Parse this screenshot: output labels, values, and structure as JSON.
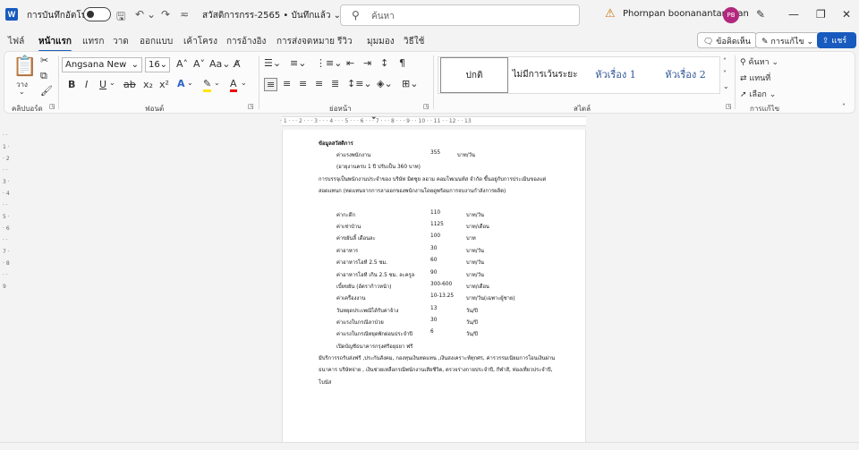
{
  "titlebar": {
    "autosave_label": "การบันทึกอัตโนมัติ",
    "doc_title": "สวัสดิการกรร-2565 • บันทึกแล้ว ⌄",
    "search_placeholder": "ค้นหา",
    "user_name": "Phornpan boonanantanasan",
    "avatar_initials": "PB"
  },
  "menu": {
    "tabs": [
      "ไฟล์",
      "หน้าแรก",
      "แทรก",
      "วาด",
      "ออกแบบ",
      "เค้าโครง",
      "การอ้างอิง",
      "การส่งจดหมาย",
      "รีวิว",
      "มุมมอง",
      "วิธีใช้"
    ],
    "comments_label": "ข้อคิดเห็น",
    "editing_label": "การแก้ไข",
    "share_label": "แชร์"
  },
  "ribbon": {
    "paste_label": "วาง",
    "clipboard_label": "คลิปบอร์ด",
    "font_name": "Angsana New",
    "font_size": "16",
    "font_group_label": "ฟอนต์",
    "paragraph_group_label": "ย่อหน้า",
    "styles_group_label": "สไตล์",
    "editing_group_label": "การแก้ไข",
    "styles": [
      "ปกติ",
      "ไม่มีการเว้นระยะ",
      "หัวเรื่อง 1",
      "หัวเรื่อง 2"
    ],
    "find_label": "ค้นหา",
    "replace_label": "แทนที่",
    "select_label": "เลือก"
  },
  "document": {
    "heading": "ข้อมูลสวัสดิการ",
    "lines": [
      {
        "label": "ค่าแรงพนักงาน",
        "value": "355",
        "unit": "บาท/วัน"
      },
      {
        "label": "(อายุงานครบ 1 ปี ปรับเป็น 360 บาท)",
        "value": "",
        "unit": ""
      },
      {
        "label": "การบรรจุเป็นพนักงานประจำของ บริษัท มิตซูย ลอาม คอมโพเนนท์ส จำกัด ขึ้นอยู่กับการประเมินของแต่",
        "value": "",
        "unit": ""
      },
      {
        "label": "สอดแทนก (ทดแทนจากการลาออกของพนักงานโดยดูพร้อมการจบงานกำลังการผลิต)",
        "value": "",
        "unit": ""
      }
    ],
    "items": [
      {
        "label": "ค่ากะดึก",
        "value": "110",
        "unit": "บาท/วัน"
      },
      {
        "label": "ค่าเช่าบ้าน",
        "value": "1125",
        "unit": "บาท/เดือน"
      },
      {
        "label": "ค่าขยันลี้ เดือนละ",
        "value": "100",
        "unit": "บาท"
      },
      {
        "label": "ค่าอาหาร",
        "value": "30",
        "unit": "บาท/วัน"
      },
      {
        "label": "ค่าอาหารโอที 2.5 ชม.",
        "value": "60",
        "unit": "บาท/วัน"
      },
      {
        "label": "ค่าอาหารโอที เกิน 2.5 ชม. ละครูล",
        "value": "90",
        "unit": "บาท/วัน"
      },
      {
        "label": "เบี้ยขยัน (อัตราก้าวหน้า)",
        "value": "300-600",
        "unit": "บาท/เดือน"
      },
      {
        "label": "ค่าเครื่องงาน",
        "value": "10-13.25",
        "unit": "บาท/วัน(เฉพาะผู้ชาย)"
      },
      {
        "label": "วันหยุดประเพณีได้รับค่าจ้าง",
        "value": "13",
        "unit": "วัน/ปี"
      },
      {
        "label": "ค่าแรงในกรณีลาป่วย",
        "value": "30",
        "unit": "วัน/ปี"
      },
      {
        "label": "ค่าแรงในกรณีหยุดพักผ่อนประจำปี",
        "value": "6",
        "unit": "วัน/ปี"
      },
      {
        "label": "เปิดบัญชีธนาคารกรุงศรีอยุธยา ฟรี",
        "value": "",
        "unit": ""
      }
    ],
    "footer": [
      "มีบริการรถรับส่งฟรี ,ประกันสังคม, กองทุนเงินทดแทน ,เงินสงเคราะห์ทุกศร, ค่ารวรรมเนียมการโอนเงินผ่าน",
      "ธนาคาร บริษัทจ่าย , เงินช่วยเหลือกรณีพนักงานเสียชีวิต, ตรวจร่างกายประจำปี, กีฬาสี, ท่องเที่ยวประจำปี,",
      "โบนัส"
    ]
  }
}
